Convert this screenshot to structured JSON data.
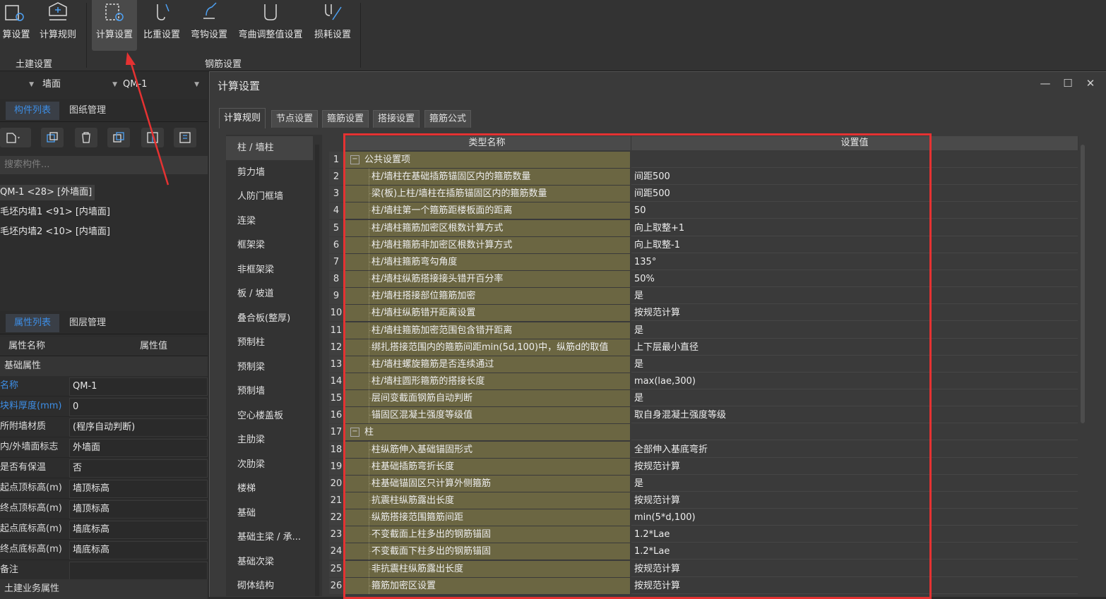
{
  "ribbon": {
    "buttons": [
      {
        "label": "算设置",
        "icon": "calc-settings-icon"
      },
      {
        "label": "计算规则",
        "icon": "calc-rules-icon"
      },
      {
        "label": "计算设置",
        "icon": "rebar-calc-settings-icon"
      },
      {
        "label": "比重设置",
        "icon": "density-settings-icon"
      },
      {
        "label": "弯钩设置",
        "icon": "hook-settings-icon"
      },
      {
        "label": "弯曲调整值设置",
        "icon": "bend-adjust-icon"
      },
      {
        "label": "损耗设置",
        "icon": "loss-settings-icon"
      }
    ],
    "groups": [
      "土建设置",
      "钢筋设置"
    ]
  },
  "left": {
    "combo1": "墙面",
    "combo2": "QM-1",
    "tabs_top": [
      "构件列表",
      "图纸管理"
    ],
    "search_placeholder": "搜索构件...",
    "components": [
      "QM-1 <28> [外墙面]",
      "毛坯内墙1 <91> [内墙面]",
      "毛坯内墙2 <10> [内墙面]"
    ],
    "tabs_bottom": [
      "属性列表",
      "图层管理"
    ],
    "prop_headers": [
      "属性名称",
      "属性值"
    ],
    "section_basic": "基础属性",
    "props": [
      {
        "k": "名称",
        "v": "QM-1",
        "blue": true
      },
      {
        "k": "块料厚度(mm)",
        "v": "0",
        "blue": true
      },
      {
        "k": "所附墙材质",
        "v": "(程序自动判断)",
        "blue": false
      },
      {
        "k": "内/外墙面标志",
        "v": "外墙面",
        "blue": false
      },
      {
        "k": "是否有保温",
        "v": "否",
        "blue": false
      },
      {
        "k": "起点顶标高(m)",
        "v": "墙顶标高",
        "blue": false
      },
      {
        "k": "终点顶标高(m)",
        "v": "墙顶标高",
        "blue": false
      },
      {
        "k": "起点底标高(m)",
        "v": "墙底标高",
        "blue": false
      },
      {
        "k": "终点底标高(m)",
        "v": "墙底标高",
        "blue": false
      },
      {
        "k": "备注",
        "v": "",
        "blue": false
      }
    ],
    "section_civil": "土建业务属性"
  },
  "dialog": {
    "title": "计算设置",
    "tabs": [
      "计算规则",
      "节点设置",
      "箍筋设置",
      "搭接设置",
      "箍筋公式"
    ],
    "categories": [
      "柱 / 墙柱",
      "剪力墙",
      "人防门框墙",
      "连梁",
      "框架梁",
      "非框架梁",
      "板 / 坡道",
      "叠合板(整厚)",
      "预制柱",
      "预制梁",
      "预制墙",
      "空心楼盖板",
      "主肋梁",
      "次肋梁",
      "楼梯",
      "基础",
      "基础主梁 / 承...",
      "基础次梁",
      "砌体结构"
    ],
    "grid_headers": [
      "类型名称",
      "设置值"
    ],
    "rows": [
      {
        "n": "1",
        "name": "公共设置项",
        "val": "",
        "group": true
      },
      {
        "n": "2",
        "name": "柱/墙柱在基础插筋锚固区内的箍筋数量",
        "val": "间距500"
      },
      {
        "n": "3",
        "name": "梁(板)上柱/墙柱在插筋锚固区内的箍筋数量",
        "val": "间距500"
      },
      {
        "n": "4",
        "name": "柱/墙柱第一个箍筋距楼板面的距离",
        "val": "50"
      },
      {
        "n": "5",
        "name": "柱/墙柱箍筋加密区根数计算方式",
        "val": "向上取整+1"
      },
      {
        "n": "6",
        "name": "柱/墙柱箍筋非加密区根数计算方式",
        "val": "向上取整-1"
      },
      {
        "n": "7",
        "name": "柱/墙柱箍筋弯勾角度",
        "val": "135°"
      },
      {
        "n": "8",
        "name": "柱/墙柱纵筋搭接接头错开百分率",
        "val": "50%"
      },
      {
        "n": "9",
        "name": "柱/墙柱搭接部位箍筋加密",
        "val": "是"
      },
      {
        "n": "10",
        "name": "柱/墙柱纵筋错开距离设置",
        "val": "按规范计算"
      },
      {
        "n": "11",
        "name": "柱/墙柱箍筋加密范围包含错开距离",
        "val": "是"
      },
      {
        "n": "12",
        "name": "绑扎搭接范围内的箍筋间距min(5d,100)中，纵筋d的取值",
        "val": "上下层最小直径"
      },
      {
        "n": "13",
        "name": "柱/墙柱螺旋箍筋是否连续通过",
        "val": "是"
      },
      {
        "n": "14",
        "name": "柱/墙柱圆形箍筋的搭接长度",
        "val": "max(lae,300)"
      },
      {
        "n": "15",
        "name": "层间变截面钢筋自动判断",
        "val": "是"
      },
      {
        "n": "16",
        "name": "锚固区混凝土强度等级值",
        "val": "取自身混凝土强度等级"
      },
      {
        "n": "17",
        "name": "柱",
        "val": "",
        "group": true
      },
      {
        "n": "18",
        "name": "柱纵筋伸入基础锚固形式",
        "val": "全部伸入基底弯折"
      },
      {
        "n": "19",
        "name": "柱基础插筋弯折长度",
        "val": "按规范计算"
      },
      {
        "n": "20",
        "name": "柱基础锚固区只计算外侧箍筋",
        "val": "是"
      },
      {
        "n": "21",
        "name": "抗震柱纵筋露出长度",
        "val": "按规范计算"
      },
      {
        "n": "22",
        "name": "纵筋搭接范围箍筋间距",
        "val": "min(5*d,100)"
      },
      {
        "n": "23",
        "name": "不变截面上柱多出的钢筋锚固",
        "val": "1.2*Lae"
      },
      {
        "n": "24",
        "name": "不变截面下柱多出的钢筋锚固",
        "val": "1.2*Lae"
      },
      {
        "n": "25",
        "name": "非抗震柱纵筋露出长度",
        "val": "按规范计算"
      },
      {
        "n": "26",
        "name": "箍筋加密区设置",
        "val": "按规范计算"
      }
    ]
  },
  "colors": {
    "accent": "#3d8ee6",
    "grid_name_bg": "#6b6642",
    "highlight": "#e53232"
  }
}
